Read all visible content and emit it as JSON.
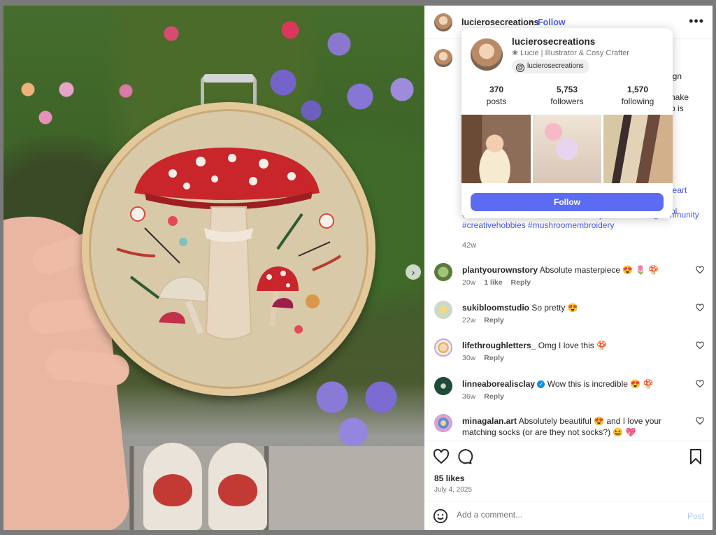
{
  "header": {
    "username": "lucierosecreations",
    "separator": "•",
    "follow_label": "Follow",
    "more_label": "•••"
  },
  "photo": {
    "next_label": "›"
  },
  "caption": {
    "fragments": [
      "",
      "ign",
      "hake",
      "o is",
      "leart",
      "ol"
    ],
    "hashtags_line1": "#mushroomart #mushroomcore #cozycrafts #craftingcommunity",
    "hashtags_line2": "#creativehobbies #mushroomembroidery",
    "age": "42w"
  },
  "hover_card": {
    "username": "lucierosecreations",
    "bio": "❀ Lucie | Illustrator & Cosy Crafter",
    "threads_handle": "lucierosecreations",
    "stats": [
      {
        "value": "370",
        "label": "posts"
      },
      {
        "value": "5,753",
        "label": "followers"
      },
      {
        "value": "1,570",
        "label": "following"
      }
    ],
    "follow_button": "Follow"
  },
  "comments": [
    {
      "user": "plantyourownstory",
      "text": "Absolute masterpiece 😍 🌷 🍄",
      "age": "20w",
      "likes": "1 like",
      "reply": "Reply",
      "verified": false
    },
    {
      "user": "sukibloomstudio",
      "text": "So pretty 😍",
      "age": "22w",
      "likes": "",
      "reply": "Reply",
      "verified": false
    },
    {
      "user": "lifethroughletters_",
      "text": "Omg I love this 🍄",
      "age": "30w",
      "likes": "",
      "reply": "Reply",
      "verified": false
    },
    {
      "user": "linneaborealisclay",
      "text": "Wow this is incredible 😍 🍄",
      "age": "36w",
      "likes": "",
      "reply": "Reply",
      "verified": true
    },
    {
      "user": "minagalan.art",
      "text": "Absolutely beautiful 😍 and I love your matching socks (or are they not socks?) 😆 💖",
      "age": "",
      "likes": "",
      "reply": "",
      "verified": false
    }
  ],
  "actions": {
    "likes": "85 likes",
    "date": "July 4, 2025"
  },
  "comment_bar": {
    "placeholder": "Add a comment...",
    "post_label": "Post"
  },
  "colors": {
    "accent": "#4a5df9",
    "follow_button": "#5c6cf2",
    "muted": "#737373"
  }
}
